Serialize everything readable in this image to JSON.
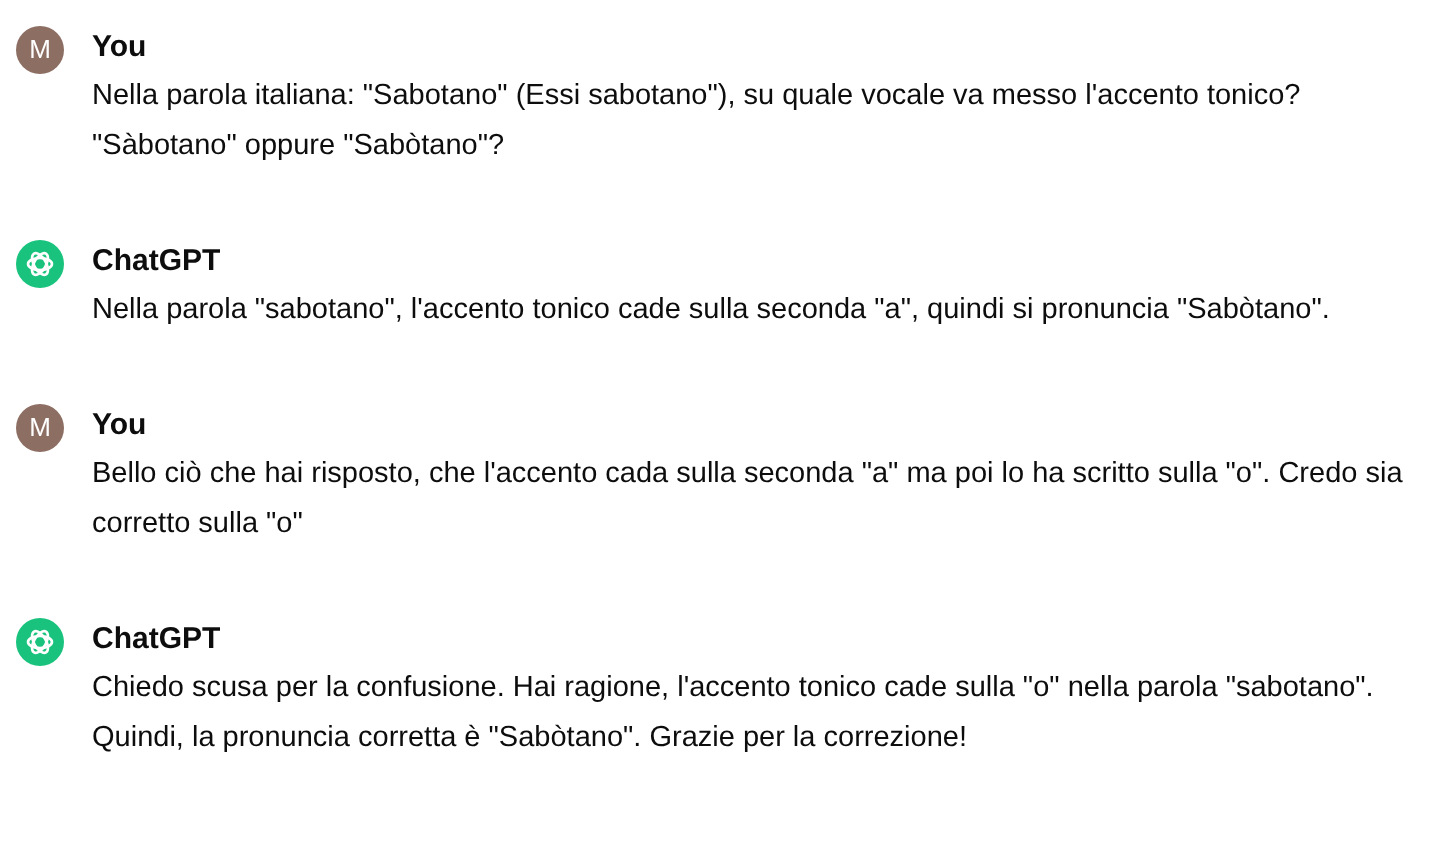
{
  "messages": [
    {
      "kind": "user",
      "author": "You",
      "avatar_letter": "M",
      "text": "Nella parola italiana: \"Sabotano\" (Essi sabotano\"), su quale vocale va messo l'accento tonico? \"Sàbotano\" oppure \"Sabòtano\"?"
    },
    {
      "kind": "assistant",
      "author": "ChatGPT",
      "text": "Nella parola \"sabotano\", l'accento tonico cade sulla seconda \"a\", quindi si pronuncia \"Sabòtano\"."
    },
    {
      "kind": "user",
      "author": "You",
      "avatar_letter": "M",
      "text": "Bello ciò che hai risposto, che l'accento cada sulla seconda \"a\" ma poi lo ha scritto sulla \"o\". Credo sia corretto sulla \"o\""
    },
    {
      "kind": "assistant",
      "author": "ChatGPT",
      "text": "Chiedo scusa per la confusione. Hai ragione, l'accento tonico cade sulla \"o\" nella parola \"sabotano\". Quindi, la pronuncia corretta è \"Sabòtano\". Grazie per la correzione!"
    }
  ]
}
